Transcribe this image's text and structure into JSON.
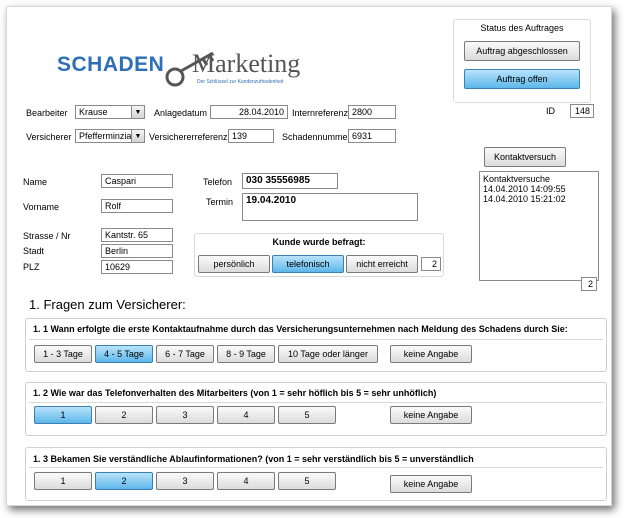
{
  "logo": {
    "schaden": "SCHADEN",
    "marketing": "Marketing",
    "tagline": "Der Schlüssel zur Kundenzufriedenheit"
  },
  "status": {
    "title": "Status des Auftrages",
    "done_label": "Auftrag abgeschlossen",
    "open_label": "Auftrag offen"
  },
  "id": {
    "label": "ID",
    "value": "148"
  },
  "form": {
    "bearbeiter_label": "Bearbeiter",
    "bearbeiter_value": "Krause",
    "anlagedatum_label": "Anlagedatum",
    "anlagedatum_value": "28.04.2010",
    "internreferenz_label": "Internreferenz",
    "internreferenz_value": "2800",
    "versicherer_label": "Versicherer",
    "versicherer_value": "Pfefferminzia",
    "versichererreferenz_label": "Versichererreferenz",
    "versichererreferenz_value": "139",
    "schadennummer_label": "Schadennummer",
    "schadennummer_value": "6931"
  },
  "contact": {
    "button": "Kontaktversuch",
    "log_lines": [
      "Kontaktversuche",
      "14.04.2010 14:09:55",
      "14.04.2010 15:21:02"
    ],
    "count": "2"
  },
  "person": {
    "name_label": "Name",
    "name_value": "Caspari",
    "vorname_label": "Vorname",
    "vorname_value": "Rolf",
    "strasse_label": "Strasse / Nr",
    "strasse_value": "Kantstr. 65",
    "stadt_label": "Stadt",
    "stadt_value": "Berlin",
    "plz_label": "PLZ",
    "plz_value": "10629"
  },
  "telefon": {
    "label": "Telefon",
    "value": "030 35556985"
  },
  "termin": {
    "label": "Termin",
    "value": "19.04.2010"
  },
  "befragt": {
    "title": "Kunde wurde befragt:",
    "buttons": [
      "persönlich",
      "telefonisch",
      "nicht erreicht"
    ],
    "selected": "telefonisch",
    "count": "2"
  },
  "section": {
    "title": "1. Fragen zum Versicherer:"
  },
  "q1": {
    "title": "1. 1  Wann erfolgte die erste Kontaktaufnahme durch das Versicherungsunternehmen nach Meldung des Schadens durch Sie:",
    "options": [
      "1 - 3 Tage",
      "4 - 5 Tage",
      "6 - 7 Tage",
      "8 - 9 Tage",
      "10 Tage oder länger"
    ],
    "selected": "4 - 5 Tage",
    "none_label": "keine Angabe"
  },
  "q2": {
    "title": "1. 2  Wie war das Telefonverhalten des Mitarbeiters (von 1 = sehr höflich bis 5 = sehr unhöflich)",
    "options": [
      "1",
      "2",
      "3",
      "4",
      "5"
    ],
    "selected": "1",
    "none_label": "keine Angabe"
  },
  "q3": {
    "title": "1. 3  Bekamen Sie verständliche Ablaufinformationen? (von 1 = sehr verständlich bis 5 = unverständlich",
    "options": [
      "1",
      "2",
      "3",
      "4",
      "5"
    ],
    "selected": "2",
    "none_label": "keine Angabe"
  },
  "colors": {
    "accent_selected": "#5db7ea",
    "logo_blue": "#2f6fb6",
    "logo_grey": "#555555"
  }
}
